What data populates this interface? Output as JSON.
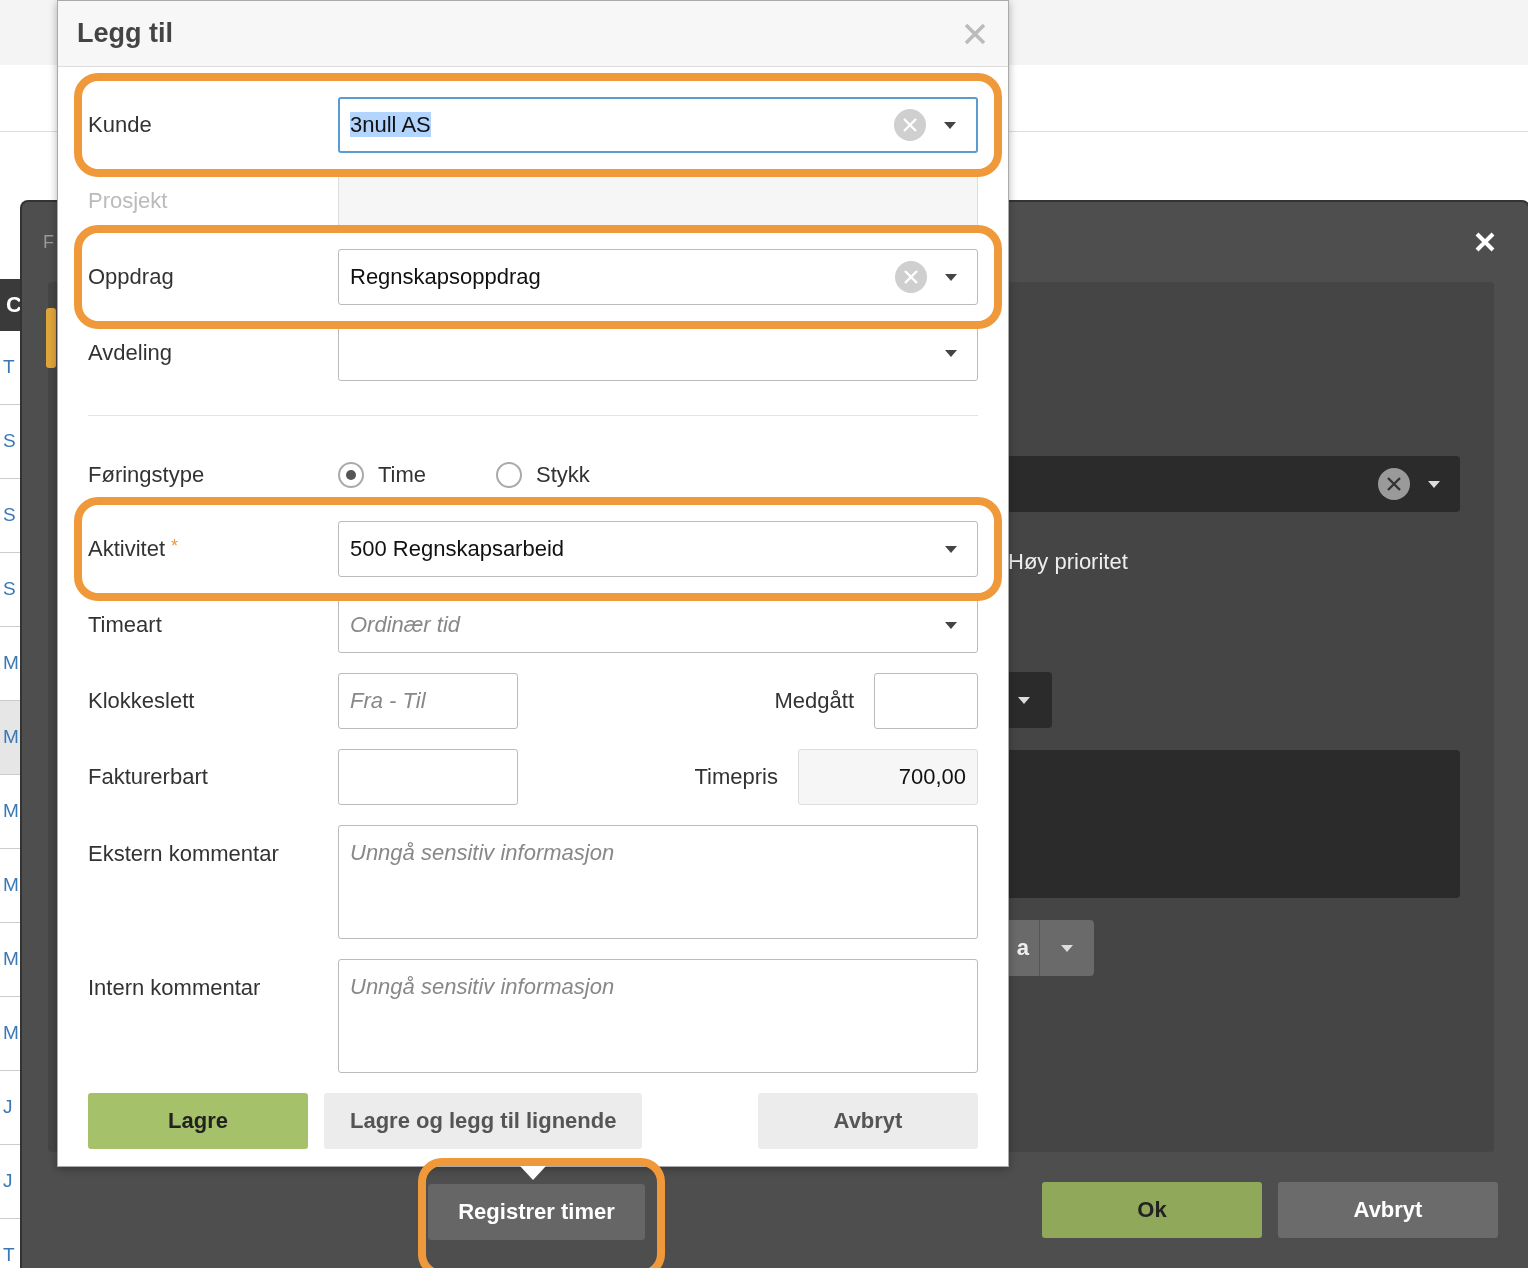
{
  "page": {
    "list_header": "C",
    "list_items": [
      {
        "text": "T",
        "selected": false
      },
      {
        "text": "S",
        "selected": false
      },
      {
        "text": "S",
        "selected": false
      },
      {
        "text": "S",
        "selected": false
      },
      {
        "text": "M",
        "selected": false
      },
      {
        "text": "M",
        "selected": true
      },
      {
        "text": "M",
        "selected": false
      },
      {
        "text": "M",
        "selected": false
      },
      {
        "text": "M",
        "selected": false
      },
      {
        "text": "M",
        "selected": false
      },
      {
        "text": "J",
        "selected": false
      },
      {
        "text": "J",
        "selected": false
      },
      {
        "text": "T",
        "selected": false
      }
    ]
  },
  "back_dialog": {
    "title": "F",
    "priority_label": "Høy prioritet",
    "split_button": "a",
    "register_button": {
      "label": "Registrer timer",
      "highlighted": true
    },
    "buttons": [
      {
        "label": "Ok",
        "kind": "primary"
      },
      {
        "label": "Avbryt",
        "kind": "secondary"
      }
    ]
  },
  "dialog": {
    "title": "Legg til",
    "fields": [
      {
        "kind": "select",
        "label": "Kunde",
        "value": "3null AS",
        "clearable": true,
        "focused": true,
        "disabled": false,
        "highlighted": true
      },
      {
        "kind": "select",
        "label": "Prosjekt",
        "clearable": false,
        "focused": false,
        "disabled": true,
        "highlighted": false
      },
      {
        "kind": "select",
        "label": "Oppdrag",
        "value": "Regnskapsoppdrag",
        "clearable": true,
        "focused": false,
        "disabled": false,
        "highlighted": true
      },
      {
        "kind": "select",
        "label": "Avdeling",
        "clearable": false,
        "focused": false,
        "disabled": false,
        "highlighted": false
      },
      {
        "kind": "divider"
      },
      {
        "kind": "radio",
        "label": "Føringstype",
        "options": [
          {
            "label": "Time",
            "selected": true
          },
          {
            "label": "Stykk",
            "selected": false
          }
        ]
      },
      {
        "kind": "select",
        "label": "Aktivitet",
        "required_mark": "*",
        "value": "500 Regnskapsarbeid",
        "clearable": false,
        "focused": false,
        "disabled": false,
        "highlighted": true
      },
      {
        "kind": "select",
        "label": "Timeart",
        "placeholder": "Ordinær tid",
        "clearable": false,
        "focused": false,
        "disabled": false,
        "highlighted": false
      },
      {
        "kind": "pair",
        "label": "Klokkeslett",
        "placeholder": "Fra - Til",
        "second_label": "Medgått"
      },
      {
        "kind": "pair",
        "label": "Fakturerbart",
        "second_label": "Timepris",
        "second_value": "700,00"
      },
      {
        "kind": "textarea",
        "label": "Ekstern kommentar",
        "placeholder": "Unngå sensitiv informasjon"
      },
      {
        "kind": "textarea",
        "label": "Intern kommentar",
        "placeholder": "Unngå sensitiv informasjon"
      }
    ],
    "buttons": [
      {
        "label": "Lagre",
        "kind": "primary"
      },
      {
        "label": "Lagre og legg til lignende",
        "kind": "secondary"
      },
      {
        "label": "Avbryt",
        "kind": "cancel"
      }
    ]
  }
}
